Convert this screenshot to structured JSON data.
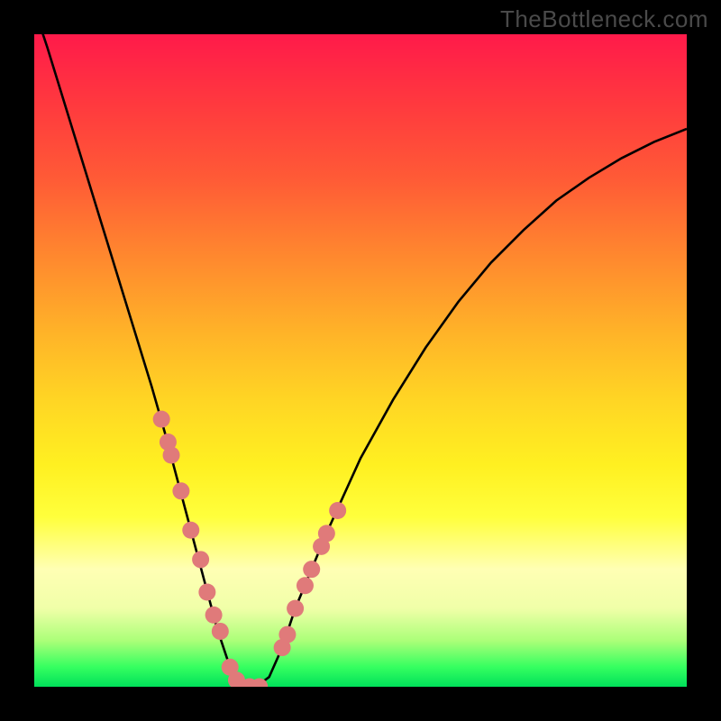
{
  "watermark": "TheBottleneck.com",
  "chart_data": {
    "type": "line",
    "title": "",
    "xlabel": "",
    "ylabel": "",
    "xlim": [
      0,
      100
    ],
    "ylim": [
      0,
      100
    ],
    "x": [
      0,
      2,
      4,
      6,
      8,
      10,
      12,
      14,
      16,
      18,
      20,
      22,
      24,
      26,
      28,
      30,
      32,
      34,
      36,
      38,
      40,
      45,
      50,
      55,
      60,
      65,
      70,
      75,
      80,
      85,
      90,
      95,
      100
    ],
    "values": [
      104,
      98,
      91.5,
      85,
      78.5,
      72,
      65.5,
      59,
      52.5,
      46,
      39,
      31.5,
      24,
      16.5,
      9,
      3,
      0,
      0,
      1.5,
      6,
      12,
      24,
      35,
      44,
      52,
      59,
      65,
      70,
      74.5,
      78,
      81,
      83.5,
      85.5
    ],
    "annotations": {
      "dots_x": [
        19.5,
        20.5,
        21.0,
        22.5,
        24.0,
        25.5,
        26.5,
        27.5,
        28.5,
        30.0,
        31.0,
        33.0,
        34.5,
        38.0,
        38.8,
        40.0,
        41.5,
        42.5,
        44.0,
        44.8,
        46.5
      ],
      "dots_y": [
        41.0,
        37.5,
        35.5,
        30.0,
        24.0,
        19.5,
        14.5,
        11.0,
        8.5,
        3.0,
        1.0,
        0.0,
        0.0,
        6.0,
        8.0,
        12.0,
        15.5,
        18.0,
        21.5,
        23.5,
        27.0
      ]
    },
    "gradient_stops": [
      {
        "pos": 0,
        "color": "#ff1a4a"
      },
      {
        "pos": 50,
        "color": "#ffd524"
      },
      {
        "pos": 80,
        "color": "#ffffb4"
      },
      {
        "pos": 100,
        "color": "#00e05a"
      }
    ]
  }
}
